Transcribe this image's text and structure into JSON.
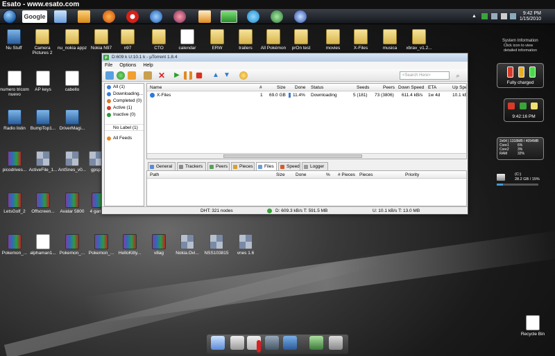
{
  "browser_bar": {
    "title": "Esato - www.esato.com"
  },
  "taskbar": {
    "google_label": "Google",
    "clock_time": "9:42 PM",
    "clock_date": "1/15/2010"
  },
  "desktop_icons": [
    {
      "label": "Nu Stuff",
      "kind": "app"
    },
    {
      "label": "Camera Pictures 2",
      "kind": "folder"
    },
    {
      "label": "nu_nokia appz",
      "kind": "folder"
    },
    {
      "label": "Nokia N97",
      "kind": "folder"
    },
    {
      "label": "n97",
      "kind": "folder"
    },
    {
      "label": "CTO",
      "kind": "folder"
    },
    {
      "label": "calendar",
      "kind": "doc"
    },
    {
      "label": "ERW",
      "kind": "folder"
    },
    {
      "label": "trailers",
      "kind": "folder"
    },
    {
      "label": "All Pokémon",
      "kind": "folder"
    },
    {
      "label": "prOn test",
      "kind": "folder"
    },
    {
      "label": "movies",
      "kind": "folder"
    },
    {
      "label": "X-Files",
      "kind": "folder"
    },
    {
      "label": "musica",
      "kind": "folder"
    },
    {
      "label": "xbrav_v1.2...",
      "kind": "folder"
    },
    {
      "label": "numero tricom nuevo",
      "kind": "doc"
    },
    {
      "label": "AP keys",
      "kind": "doc"
    },
    {
      "label": "cabello",
      "kind": "doc"
    },
    {
      "label": "Radio listin",
      "kind": "app"
    },
    {
      "label": "BumpTop1...",
      "kind": "app"
    },
    {
      "label": "DriverMagi...",
      "kind": "app"
    },
    {
      "label": "picodrives...",
      "kind": "rar"
    },
    {
      "label": "ActiveFile_1...",
      "kind": "grid"
    },
    {
      "label": "AntSnes_v0...",
      "kind": "grid"
    },
    {
      "label": "gpsp",
      "kind": "grid"
    },
    {
      "label": "LetsGolf_2",
      "kind": "rar"
    },
    {
      "label": "Offscreen...",
      "kind": "rar"
    },
    {
      "label": "Avatar 5800",
      "kind": "rar"
    },
    {
      "label": "4 games",
      "kind": "rar"
    },
    {
      "label": "Pokemon_...",
      "kind": "rar"
    },
    {
      "label": "alphaman1...",
      "kind": "doc"
    },
    {
      "label": "Pokemon_...",
      "kind": "rar"
    },
    {
      "label": "Pokemon_...",
      "kind": "rar"
    },
    {
      "label": "HelloKitty...",
      "kind": "rar"
    },
    {
      "label": "v8ag",
      "kind": "rar"
    },
    {
      "label": "Nokia.Ovi...",
      "kind": "grid"
    },
    {
      "label": "NSS103815",
      "kind": "grid"
    },
    {
      "label": "vnes 1.6",
      "kind": "grid"
    },
    {
      "label": "Recycle Bin",
      "kind": "bin"
    }
  ],
  "gadgets": {
    "sysinfo_title": "System Information",
    "sysinfo_sub": "Click icon to view detailed information",
    "battery_label": "Fully charged",
    "gadget_clock": "9:42:16 PM",
    "cpu_header": "2x64 | 1318MB / 4094MB",
    "cpu_rows": [
      {
        "label": "Core1",
        "value": "6%"
      },
      {
        "label": "Core2",
        "value": "3%"
      },
      {
        "label": "RAM",
        "value": "32%"
      }
    ],
    "drive_label": "(C:)",
    "drive_value": "28.2 GB / 15%"
  },
  "utorrent": {
    "title": "D:609 k U:10.1 k - µTorrent 1.8.4",
    "menu": [
      "File",
      "Options",
      "Help"
    ],
    "search_placeholder": "<Search Here>",
    "sidebar": [
      {
        "label": "All (1)",
        "color": "#3c7bd8"
      },
      {
        "label": "Downloading...",
        "color": "#3c7bd8"
      },
      {
        "label": "Completed (0)",
        "color": "#d87a2a"
      },
      {
        "label": "Active (1)",
        "color": "#d83a2a"
      },
      {
        "label": "Inactive (0)",
        "color": "#2a9a3a"
      },
      {
        "label": "No Label (1)",
        "color": ""
      },
      {
        "label": "All Feeds",
        "color": "#e08a20"
      }
    ],
    "columns": [
      "Name",
      "#",
      "Size",
      "Done",
      "Status",
      "Seeds",
      "Peers",
      "Down Speed",
      "ETA",
      "Up Spe"
    ],
    "torrent": {
      "name": "X-Files",
      "num": "1",
      "size": "69.0 GB",
      "done": "11.4%",
      "done_fraction": 0.114,
      "status": "Downloading",
      "seeds": "5 (181)",
      "peers": "73 (3806)",
      "down": "611.4 kB/s",
      "eta": "1w 4d",
      "up": "10.1 kE"
    },
    "tabs": [
      "General",
      "Trackers",
      "Peers",
      "Pieces",
      "Files",
      "Speed",
      "Logger"
    ],
    "active_tab": "Files",
    "file_columns": [
      "Path",
      "Size",
      "Done",
      "%",
      "# Pieces",
      "Pieces",
      "Priority"
    ],
    "status": {
      "dht": "DHT: 321 nodes",
      "down": "D: 609.3 kB/s T: 591.5 MB",
      "up": "U: 10.1 kB/s T: 13.0 MB"
    }
  }
}
